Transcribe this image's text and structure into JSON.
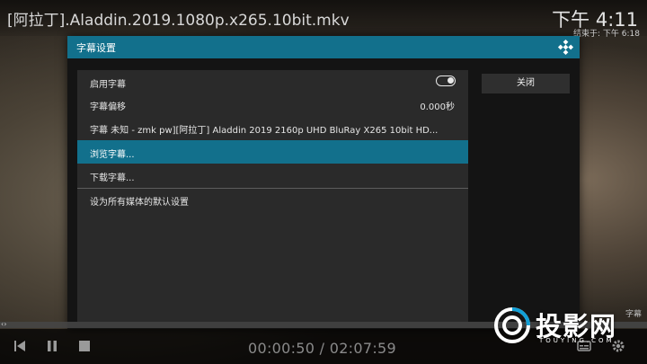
{
  "player": {
    "filename": "[阿拉丁].Aladdin.2019.1080p.x265.10bit.mkv",
    "clock": "下午 4:11",
    "ends_at": "结束于: 下午 6:18",
    "time_display": "00:00:50 / 02:07:59",
    "corner_text": "字幕",
    "progress_fraction": 0.0065
  },
  "dialog": {
    "title": "字幕设置",
    "close_label": "关闭",
    "items": [
      {
        "label": "启用字幕",
        "control": "toggle",
        "toggle_on": true
      },
      {
        "label": "字幕偏移",
        "value": "0.000秒"
      },
      {
        "label": "字幕   未知 - zmk pw][阿拉丁] Aladdin 2019 2160p UHD BluRay X265 10bit HD..."
      },
      {
        "label": "浏览字幕...",
        "focused": true
      },
      {
        "label": "下载字幕..."
      },
      {
        "label": "设为所有媒体的默认设置"
      }
    ]
  },
  "watermark": {
    "brand": "投影网",
    "domain": "TOUYING.COM"
  },
  "colors": {
    "accent": "#12708c",
    "dialog_bg": "#141414",
    "panel_bg": "#2a2a2a",
    "kodi_logo": "#12a0d7"
  },
  "icons": [
    "kodi-logo-icon",
    "skip-back-icon",
    "pause-icon",
    "stop-icon",
    "subtitle-icon",
    "settings-icon",
    "touying-logo-icon"
  ]
}
